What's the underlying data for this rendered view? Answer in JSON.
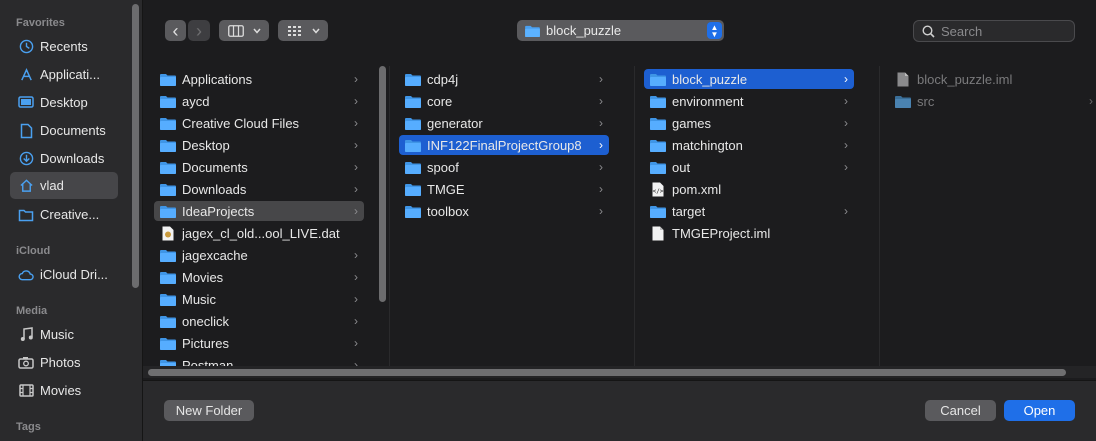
{
  "sidebar": {
    "sections": {
      "favorites": "Favorites",
      "icloud": "iCloud",
      "media": "Media",
      "tags": "Tags"
    },
    "favorites": [
      {
        "label": "Recents",
        "icon": "clock-icon"
      },
      {
        "label": "Applicati...",
        "icon": "applications-icon"
      },
      {
        "label": "Desktop",
        "icon": "desktop-icon"
      },
      {
        "label": "Documents",
        "icon": "document-icon"
      },
      {
        "label": "Downloads",
        "icon": "download-icon"
      },
      {
        "label": "vlad",
        "icon": "home-icon",
        "selected": true
      },
      {
        "label": "Creative...",
        "icon": "folder-icon"
      }
    ],
    "icloud": [
      {
        "label": "iCloud Dri...",
        "icon": "cloud-icon"
      }
    ],
    "media": [
      {
        "label": "Music",
        "icon": "music-note-icon"
      },
      {
        "label": "Photos",
        "icon": "camera-icon"
      },
      {
        "label": "Movies",
        "icon": "film-icon"
      }
    ]
  },
  "toolbar": {
    "back": "‹",
    "forward": "›",
    "path_label": "block_puzzle",
    "search_placeholder": "Search"
  },
  "columns": [
    {
      "items": [
        {
          "label": "Applications",
          "kind": "folder",
          "chevron": true
        },
        {
          "label": "aycd",
          "kind": "folder",
          "chevron": true
        },
        {
          "label": "Creative Cloud Files",
          "kind": "folder",
          "chevron": true
        },
        {
          "label": "Desktop",
          "kind": "folder",
          "chevron": true
        },
        {
          "label": "Documents",
          "kind": "folder",
          "chevron": true
        },
        {
          "label": "Downloads",
          "kind": "folder",
          "chevron": true
        },
        {
          "label": "IdeaProjects",
          "kind": "folder",
          "chevron": true,
          "selected": "gray"
        },
        {
          "label": "jagex_cl_old...ool_LIVE.dat",
          "kind": "file-image",
          "chevron": false
        },
        {
          "label": "jagexcache",
          "kind": "folder",
          "chevron": true
        },
        {
          "label": "Movies",
          "kind": "folder",
          "chevron": true
        },
        {
          "label": "Music",
          "kind": "folder",
          "chevron": true
        },
        {
          "label": "oneclick",
          "kind": "folder",
          "chevron": true
        },
        {
          "label": "Pictures",
          "kind": "folder",
          "chevron": true
        },
        {
          "label": "Postman",
          "kind": "folder",
          "chevron": true
        }
      ]
    },
    {
      "items": [
        {
          "label": "cdp4j",
          "kind": "folder",
          "chevron": true
        },
        {
          "label": "core",
          "kind": "folder",
          "chevron": true
        },
        {
          "label": "generator",
          "kind": "folder",
          "chevron": true
        },
        {
          "label": "INF122FinalProjectGroup8",
          "kind": "folder",
          "chevron": true,
          "selected": "blue"
        },
        {
          "label": "spoof",
          "kind": "folder",
          "chevron": true
        },
        {
          "label": "TMGE",
          "kind": "folder",
          "chevron": true
        },
        {
          "label": "toolbox",
          "kind": "folder",
          "chevron": true
        }
      ]
    },
    {
      "items": [
        {
          "label": "block_puzzle",
          "kind": "folder",
          "chevron": true,
          "selected": "blue"
        },
        {
          "label": "environment",
          "kind": "folder",
          "chevron": true
        },
        {
          "label": "games",
          "kind": "folder",
          "chevron": true
        },
        {
          "label": "matchington",
          "kind": "folder",
          "chevron": true
        },
        {
          "label": "out",
          "kind": "folder",
          "chevron": true
        },
        {
          "label": "pom.xml",
          "kind": "file-code",
          "chevron": false
        },
        {
          "label": "target",
          "kind": "folder",
          "chevron": true
        },
        {
          "label": "TMGEProject.iml",
          "kind": "file",
          "chevron": false
        }
      ]
    },
    {
      "items": [
        {
          "label": "block_puzzle.iml",
          "kind": "file",
          "chevron": false,
          "dim": true
        },
        {
          "label": "src",
          "kind": "folder",
          "chevron": true,
          "dim": true
        }
      ]
    }
  ],
  "footer": {
    "new_folder": "New Folder",
    "cancel": "Cancel",
    "open": "Open"
  },
  "colors": {
    "accent": "#1f6fe8",
    "folder": "#4aa0f0",
    "selected_gray": "#474749"
  }
}
